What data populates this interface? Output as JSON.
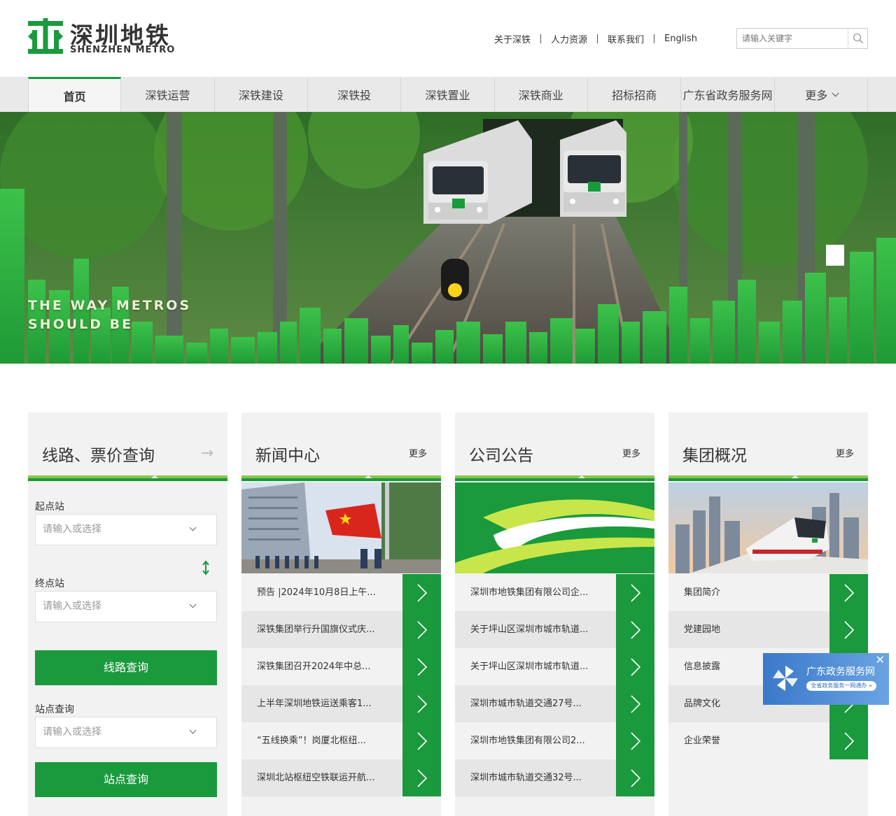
{
  "brand": {
    "name_cn": "深圳地铁",
    "name_en": "SHENZHEN METRO",
    "color": "#1a9a3c"
  },
  "toplinks": [
    "关于深铁",
    "人力资源",
    "联系我们",
    "English"
  ],
  "search": {
    "placeholder": "请输入关键字",
    "icon": "search-icon"
  },
  "nav": [
    "首页",
    "深铁运营",
    "深铁建设",
    "深铁投",
    "深铁置业",
    "深铁商业",
    "招标招商",
    "广东省政务服务网",
    "更多"
  ],
  "banner": {
    "slogan": "THE WAY METROS\nSHOULD BE"
  },
  "query": {
    "title": "线路、票价查询",
    "start_label": "起点站",
    "end_label": "终点站",
    "select_placeholder": "请输入或选择",
    "route_button": "线路查询",
    "station_label": "站点查询",
    "station_button": "站点查询"
  },
  "news": {
    "title": "新闻中心",
    "more": "更多",
    "items": [
      "预告 |2024年10月8日上午...",
      "深铁集团举行升国旗仪式庆...",
      "深铁集团召开2024年中总...",
      "上半年深圳地铁运送乘客1...",
      "“五线换乘”！岗厦北枢纽...",
      "深圳北站枢纽空铁联运开航..."
    ]
  },
  "notices": {
    "title": "公司公告",
    "more": "更多",
    "items": [
      "深圳市地铁集团有限公司企...",
      "关于坪山区深圳市城市轨道...",
      "关于坪山区深圳市城市轨道...",
      "深圳市城市轨道交通27号...",
      "深圳市地铁集团有限公司2...",
      "深圳市城市轨道交通32号..."
    ]
  },
  "group": {
    "title": "集团概况",
    "more": "更多",
    "items": [
      "集团简介",
      "党建园地",
      "信息披露",
      "品牌文化",
      "企业荣誉"
    ]
  },
  "float_ad": {
    "title": "广东政务服务网",
    "subtitle": "全省政务服务一网通办 »",
    "close": "✕"
  }
}
